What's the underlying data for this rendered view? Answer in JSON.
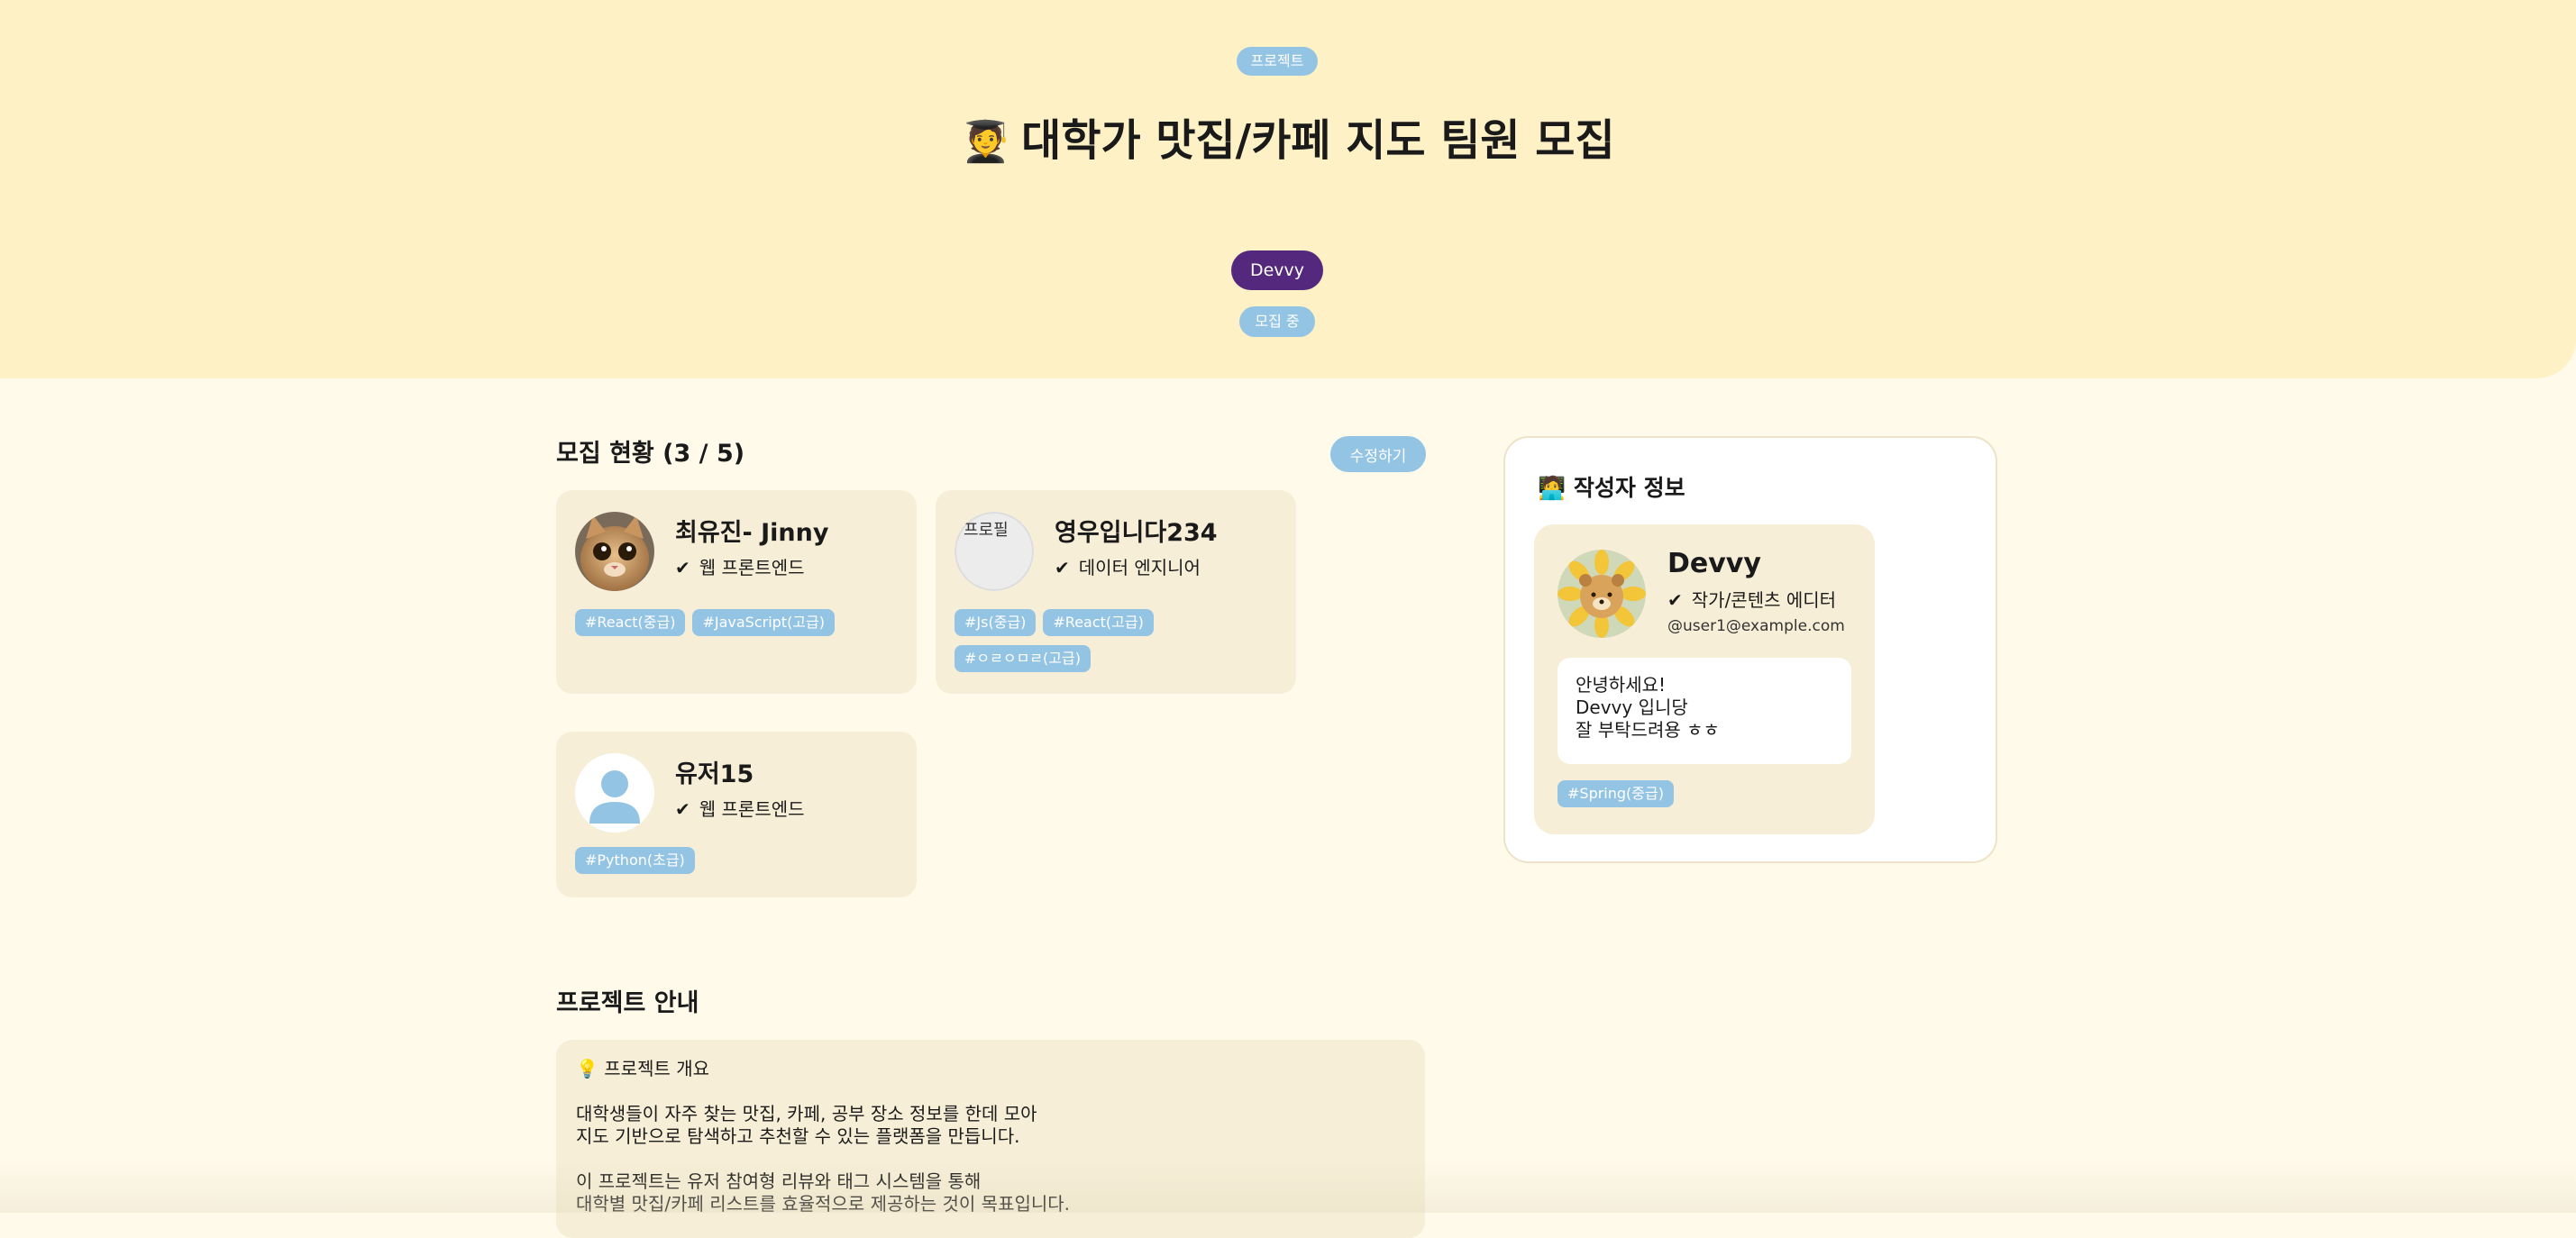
{
  "hero": {
    "type_badge": "프로젝트",
    "title_emoji": "🧑‍🎓",
    "title": "대학가 맛집/카페 지도 팀원 모집",
    "author_badge": "Devvy",
    "status_badge": "모집 중"
  },
  "recruit": {
    "title": "모집 현황 (3 / 5)",
    "edit_label": "수정하기",
    "check_mark": "✔",
    "members": [
      {
        "name": "최유진- Jinny",
        "role": "웹 프론트엔드",
        "avatar": "cat-photo",
        "tags": [
          "#React(중급)",
          "#JavaScript(고급)"
        ]
      },
      {
        "name": "영우입니다234",
        "role": "데이터 엔지니어",
        "avatar": "broken-image",
        "avatar_alt": "프로필",
        "tags": [
          "#Js(중급)",
          "#React(고급)",
          "#ㅇㄹㅇㅁㄹ(고급)"
        ]
      },
      {
        "name": "유저15",
        "role": "웹 프론트엔드",
        "avatar": "default-user-icon",
        "tags": [
          "#Python(초급)"
        ]
      }
    ]
  },
  "author": {
    "panel_title": "작성자 정보",
    "panel_emoji": "🧑‍💻",
    "name": "Devvy",
    "role": "작가/콘텐츠 에디터",
    "email": "@user1@example.com",
    "avatar": "sunflower-bear-photo",
    "bio_lines": [
      "안녕하세요!",
      "Devvy 입니당",
      "잘 부탁드려용 ㅎㅎ"
    ],
    "tags": [
      "#Spring(중급)"
    ]
  },
  "project_info": {
    "title": "프로젝트 안내",
    "heading_emoji": "💡",
    "heading": "프로젝트 개요",
    "paragraph1": [
      "대학생들이 자주 찾는 맛집, 카페, 공부 장소 정보를 한데 모아",
      "지도 기반으로 탐색하고 추천할 수 있는 플랫폼을 만듭니다."
    ],
    "paragraph2": [
      "이 프로젝트는 유저 참여형 리뷰와 태그 시스템을 통해",
      "대학별 맛집/카페 리스트를 효율적으로 제공하는 것이 목표입니다."
    ]
  },
  "colors": {
    "hero_bg": "#fff1c6",
    "page_bg": "#fffaea",
    "card_bg": "#f6eed6",
    "accent_blue": "#94c4e4",
    "author_purple": "#54287c"
  }
}
